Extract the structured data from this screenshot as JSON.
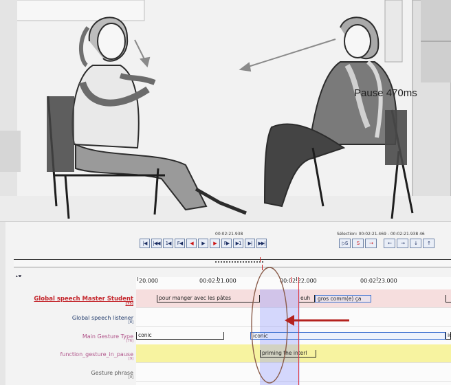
{
  "player": {
    "current_time": "00:02:21.938",
    "selection_text": "Sélection: 00:02:21.469 - 00:02:21.938  46",
    "controls": [
      "|◀",
      "|◀◀",
      "1◀",
      "F◀",
      "◀",
      "▶",
      "▶",
      "F▶",
      "▶1",
      "▶|",
      "▶▶|"
    ],
    "selection_controls": [
      "▷S",
      "S",
      "→",
      "←",
      "→",
      "↓",
      "↑"
    ]
  },
  "timeline": {
    "ticks": [
      "20.000",
      "00:02:21.000",
      "00:02:22.000",
      "00:02:23.000"
    ],
    "tiers": [
      {
        "name": "Global speech Master Student",
        "sub": "[75]"
      },
      {
        "name": "Global speech listener",
        "sub": "[8]"
      },
      {
        "name": "Main Gesture Type",
        "sub": "[76]"
      },
      {
        "name": "function_gesture_in_pause",
        "sub": "[9]"
      },
      {
        "name": "Gesture phrase",
        "sub": "[0]"
      }
    ],
    "annotations": {
      "speech_1": "pour manger avec les pâtes",
      "speech_2": "euh",
      "speech_3": "gros comm(e) ça",
      "gesture_1": "conic",
      "gesture_2": "iconic",
      "gesture_3": "ic",
      "pause_function": "priming the interl"
    }
  },
  "callout": {
    "label": "Pause 470ms",
    "color": "#b4221e"
  },
  "colors": {
    "selection": "#8c96ff",
    "cursor": "#e0323a",
    "yellow_tier": "#f7f3a0"
  }
}
